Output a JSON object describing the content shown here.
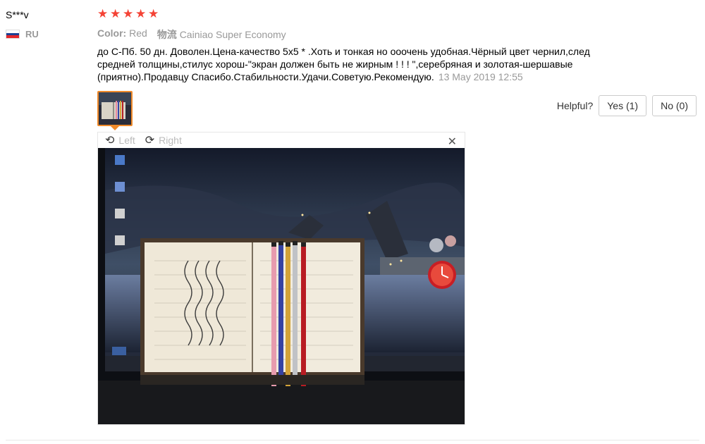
{
  "user": {
    "name": "S***v",
    "country_code": "RU",
    "flag_colors": [
      "#ffffff",
      "#1c3f94",
      "#e3262a"
    ]
  },
  "rating": {
    "stars": 5,
    "color": "#f44336"
  },
  "order": {
    "color_label": "Color:",
    "color_value": "Red",
    "shipping_label": "物流",
    "shipping_value": "Cainiao Super Economy"
  },
  "review": {
    "text": "до С-Пб. 50 дн. Доволен.Цена-качество 5х5 * .Хоть и тонкая но ооочень удобная.Чёрный цвет чернил,след средней толщины,стилус хорош-\"экран должен быть не жирным ! ! ! \",серебряная и золотая-шершавые (приятно).Продавцу Спасибо.Стабильности.Удачи.Советую.Рекомендую.",
    "date": "13 May 2019 12:55"
  },
  "helpful": {
    "label": "Helpful?",
    "yes": "Yes (1)",
    "no": "No (0)"
  },
  "viewer": {
    "rotate_left": "Left",
    "rotate_right": "Right",
    "close_icon": "close-icon"
  },
  "colors": {
    "accent": "#f08a2a",
    "muted": "#999999"
  }
}
